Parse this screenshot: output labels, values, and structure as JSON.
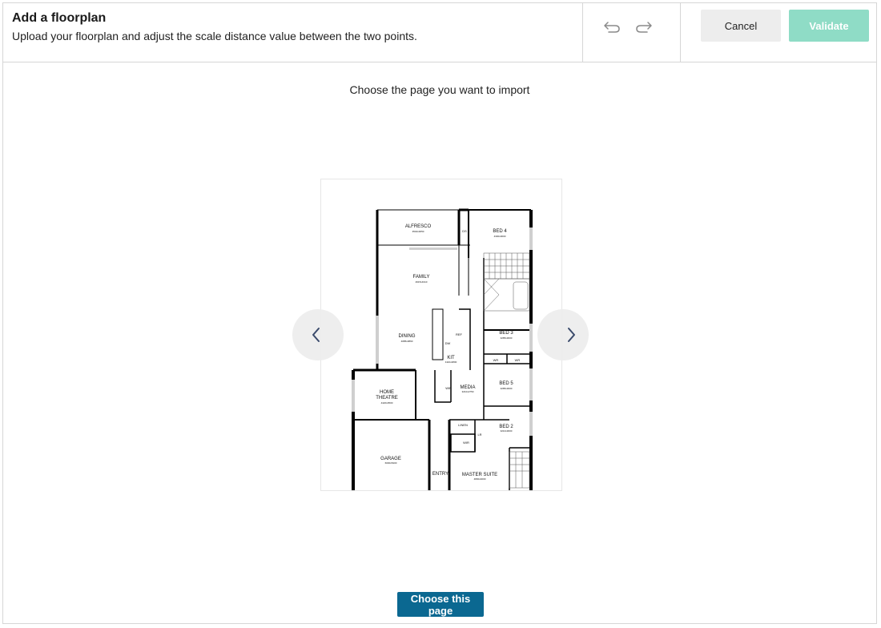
{
  "header": {
    "title": "Add a floorplan",
    "subtitle": "Upload your floorplan and adjust the scale distance value between the two points.",
    "cancel_label": "Cancel",
    "validate_label": "Validate",
    "undo_icon": "undo-icon",
    "redo_icon": "redo-icon"
  },
  "main": {
    "prompt": "Choose the page you want to import",
    "choose_label": "Choose this page",
    "prev_icon": "chevron-left-icon",
    "next_icon": "chevron-right-icon"
  },
  "floorplan": {
    "rooms": [
      {
        "name": "ALFRESCO",
        "dims": "3540x3050"
      },
      {
        "name": "BED 4",
        "dims": "4300x3000"
      },
      {
        "name": "FAMILY",
        "dims": "4615x4310"
      },
      {
        "name": "DINING",
        "dims": "4085x3860"
      },
      {
        "name": "BED 3",
        "dims": "3285x3000"
      },
      {
        "name": "KIT",
        "dims": "4110x2800"
      },
      {
        "name": "BED 5",
        "dims": "3285x3000"
      },
      {
        "name": "MEDIA",
        "dims": "3210x2750"
      },
      {
        "name": "HOME",
        "dims": ""
      },
      {
        "name": "THEATRE",
        "dims": "4420x3500"
      },
      {
        "name": "BED 2",
        "dims": "3210x3000"
      },
      {
        "name": "GARAGE",
        "dims": "6000x5400"
      },
      {
        "name": "ENTRY",
        "dims": ""
      },
      {
        "name": "MASTER SUITE",
        "dims": "4800x4000"
      }
    ],
    "labels": {
      "wip": "WIP",
      "wir": "WIR",
      "wr1": "WR",
      "wr2": "WR",
      "linen": "LINEN",
      "lr": "LR",
      "ds": "DS",
      "dw": "DW",
      "ref": "REF"
    },
    "colors": {
      "wall": "#000000",
      "tile": "#555555"
    }
  },
  "colors": {
    "validate_bg": "#8fdcc6",
    "cancel_bg": "#ededed",
    "choose_bg": "#0b6891",
    "border": "#d6d6d6"
  }
}
